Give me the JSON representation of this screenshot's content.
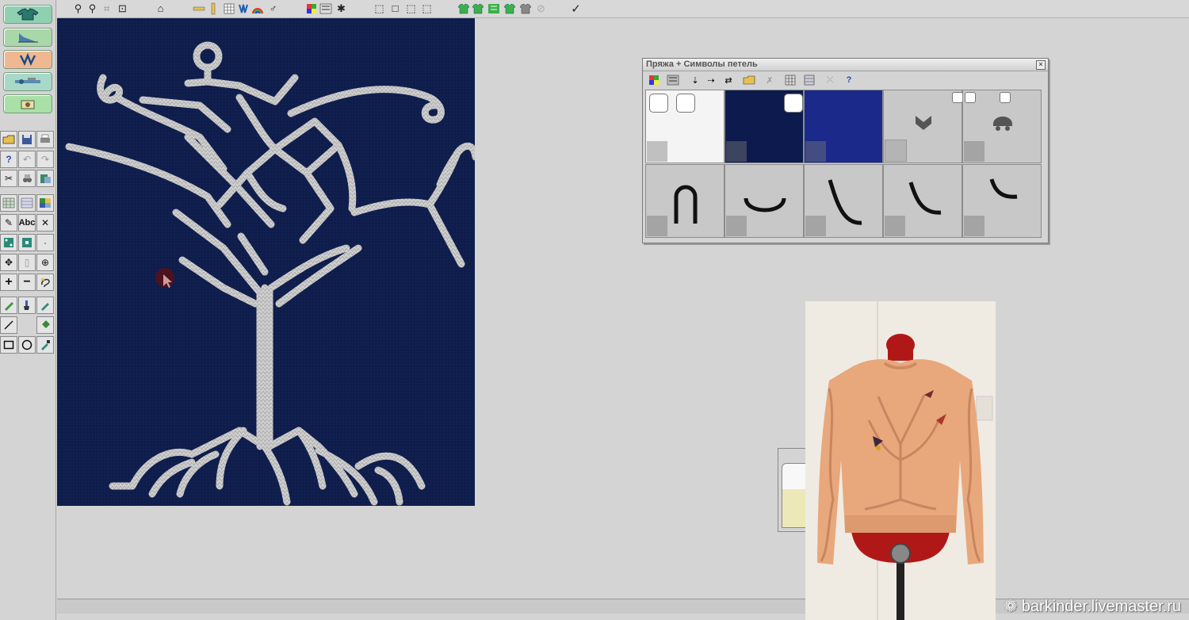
{
  "palette_window": {
    "title": "Пряжа + Символы петель"
  },
  "palette": {
    "yarn_colors": [
      "#f4f4f4",
      "#0c1a4e",
      "#1b2a8a",
      "#c8c8c8",
      "#c8c8c8"
    ],
    "stitch_symbols": [
      "n-loop-symbol",
      "u-curve-symbol",
      "hook-large-symbol",
      "hook-medium-symbol",
      "hook-small-symbol"
    ]
  },
  "canvas": {
    "background": "#0e1c4a",
    "stitch_color": "#c9c9c9"
  },
  "watermark": {
    "text": "barkinder.livemaster.ru"
  }
}
